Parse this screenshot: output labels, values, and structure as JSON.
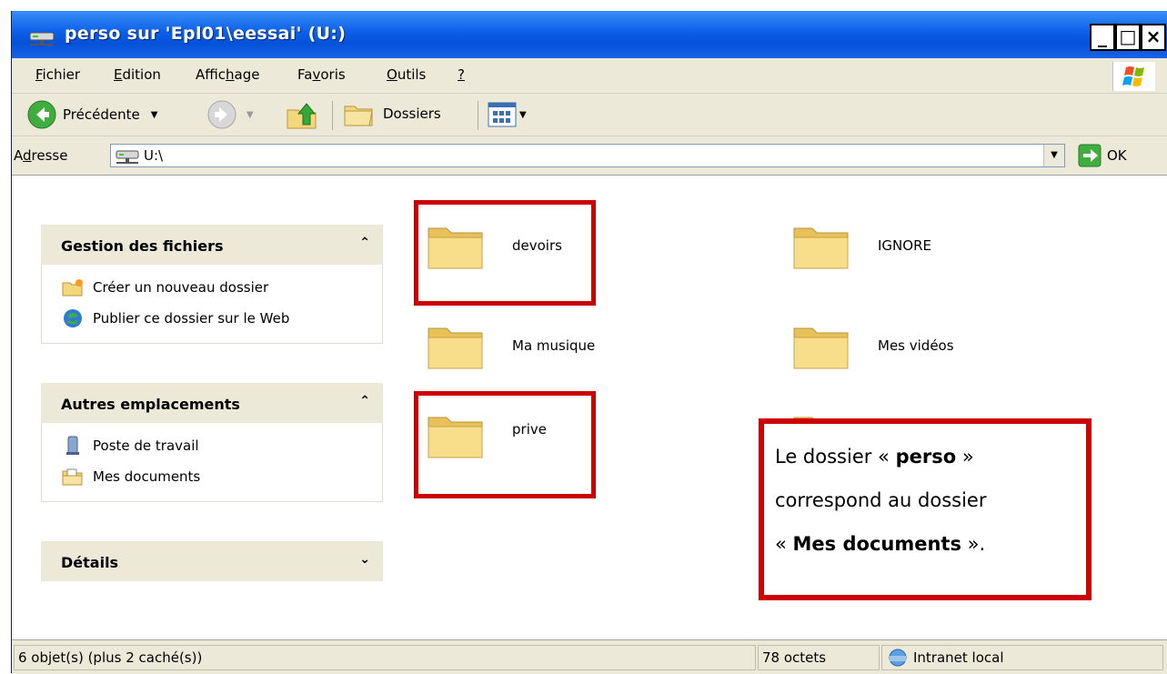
{
  "window": {
    "title": "perso sur 'Epl01\\eessai' (U:)"
  },
  "controls": {
    "minimize": "_",
    "maximize": "□",
    "close": "×"
  },
  "menubar": {
    "items": [
      {
        "pre": "",
        "u": "F",
        "post": "ichier"
      },
      {
        "pre": "",
        "u": "E",
        "post": "dition"
      },
      {
        "pre": "Affic",
        "u": "h",
        "post": "age"
      },
      {
        "pre": "Fa",
        "u": "v",
        "post": "oris"
      },
      {
        "pre": "",
        "u": "O",
        "post": "utils"
      },
      {
        "pre": "",
        "u": "?",
        "post": ""
      }
    ]
  },
  "toolbar": {
    "back_label": "Précédente",
    "folders_label": "Dossiers"
  },
  "address": {
    "label_pre": "A",
    "label_u": "d",
    "label_post": "resse",
    "value": "U:\\",
    "go_label": "OK"
  },
  "left_panels": [
    {
      "title": "Gestion des fichiers",
      "items": [
        "Créer un nouveau dossier",
        "Publier ce dossier sur le Web"
      ]
    },
    {
      "title": "Autres emplacements",
      "items": [
        "Poste de travail",
        "Mes documents"
      ]
    },
    {
      "title": "Détails"
    }
  ],
  "folders": [
    "devoirs",
    "IGNORE",
    "Ma musique",
    "Mes vidéos",
    "prive"
  ],
  "note": {
    "line1_pre": "Le dossier « ",
    "line1_bold": "perso",
    "line1_post": " »",
    "line2": "correspond au dossier",
    "line3_pre": "« ",
    "line3_bold": "Mes documents",
    "line3_post": " »."
  },
  "status": {
    "objects": "6 objet(s) (plus 2 caché(s))",
    "size": "78 octets",
    "zone": "Intranet local"
  },
  "colors": {
    "highlight": "#cc0000",
    "titlebar": "#0b5fe8",
    "folder": "#f3d77b"
  }
}
